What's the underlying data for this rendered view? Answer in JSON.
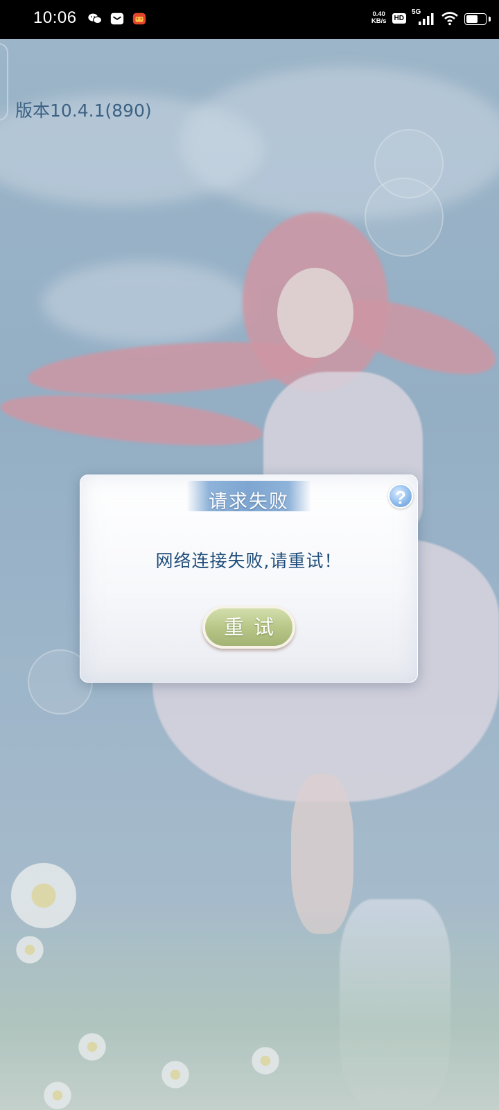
{
  "status_bar": {
    "time": "10:06",
    "net_speed_value": "0.40",
    "net_speed_unit": "KB/s",
    "hd_label": "HD",
    "signal_label": "5G",
    "battery_level": 0.65
  },
  "app": {
    "version": "版本10.4.1(890)"
  },
  "dialog": {
    "title": "请求失败",
    "help_label": "?",
    "message": "网络连接失败,请重试！",
    "retry_label": "重试"
  },
  "colors": {
    "dialog_message": "#1f4d7a",
    "retry_button": "#b6c585",
    "title_banner": "#7ea6d1"
  }
}
